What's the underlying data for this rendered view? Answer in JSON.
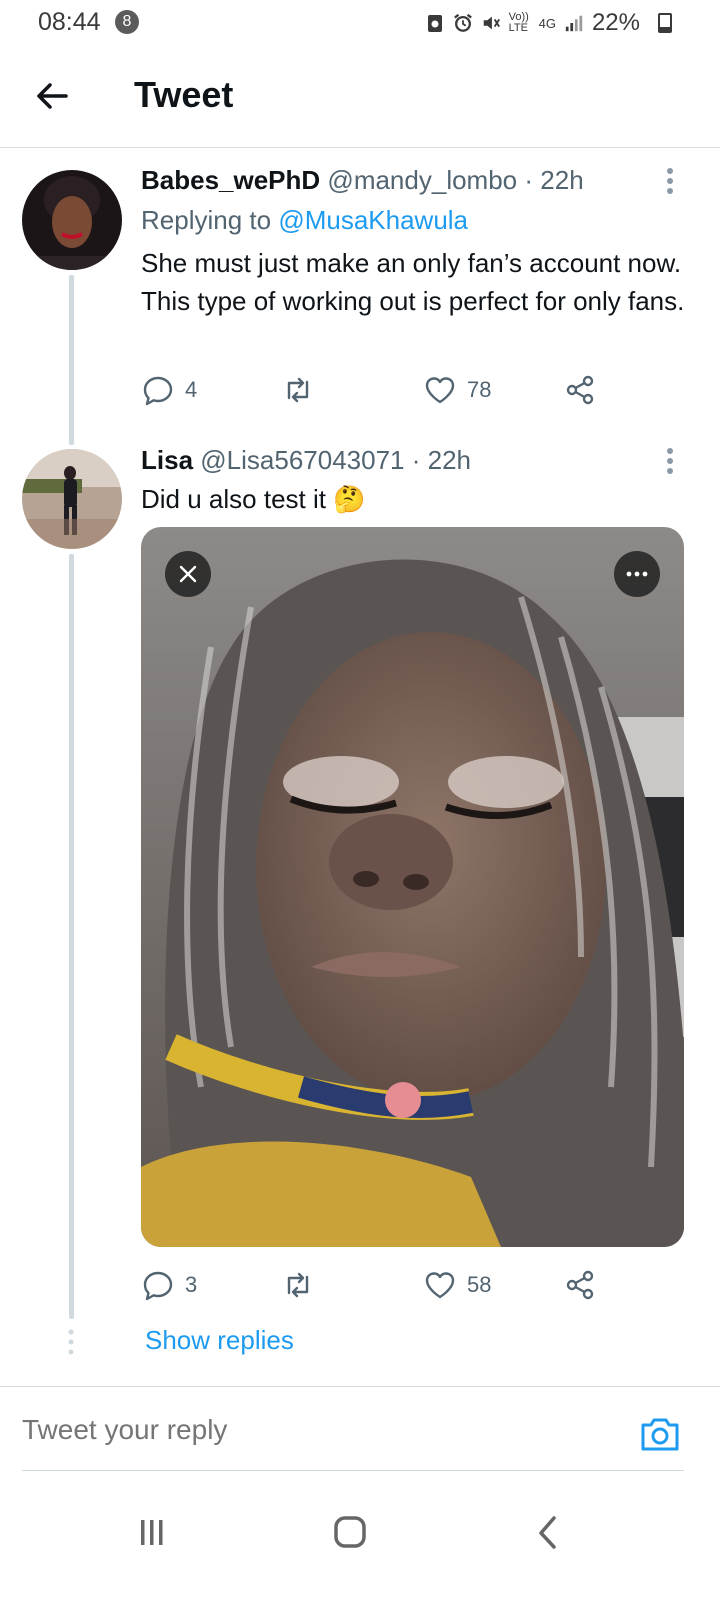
{
  "status_bar": {
    "time": "08:44",
    "notification_count": "8",
    "network_volte": "Vo)) LTE",
    "network_gen": "4G",
    "battery_percent": "22%",
    "battery_level": 0.22
  },
  "header": {
    "title": "Tweet"
  },
  "tweets": [
    {
      "display_name": "Babes_wePhD",
      "handle": "@mandy_lombo",
      "separator": "·",
      "time": "22h",
      "replying_prefix": "Replying to",
      "replying_to": "@MusaKhawula",
      "text": "She must just make an only fan’s account now. This type of working out is perfect for only fans.",
      "replies": "4",
      "retweets": "",
      "likes": "78"
    },
    {
      "display_name": "Lisa",
      "handle": "@Lisa567043071",
      "separator": "·",
      "time": "22h",
      "text": "Did u also test it 🤔",
      "replies": "3",
      "retweets": "",
      "likes": "58"
    }
  ],
  "show_replies": "Show replies",
  "composer": {
    "placeholder": "Tweet your reply"
  },
  "colors": {
    "accent": "#1d9bf0",
    "muted_text": "#536471",
    "thread_line": "#cfd9de"
  }
}
